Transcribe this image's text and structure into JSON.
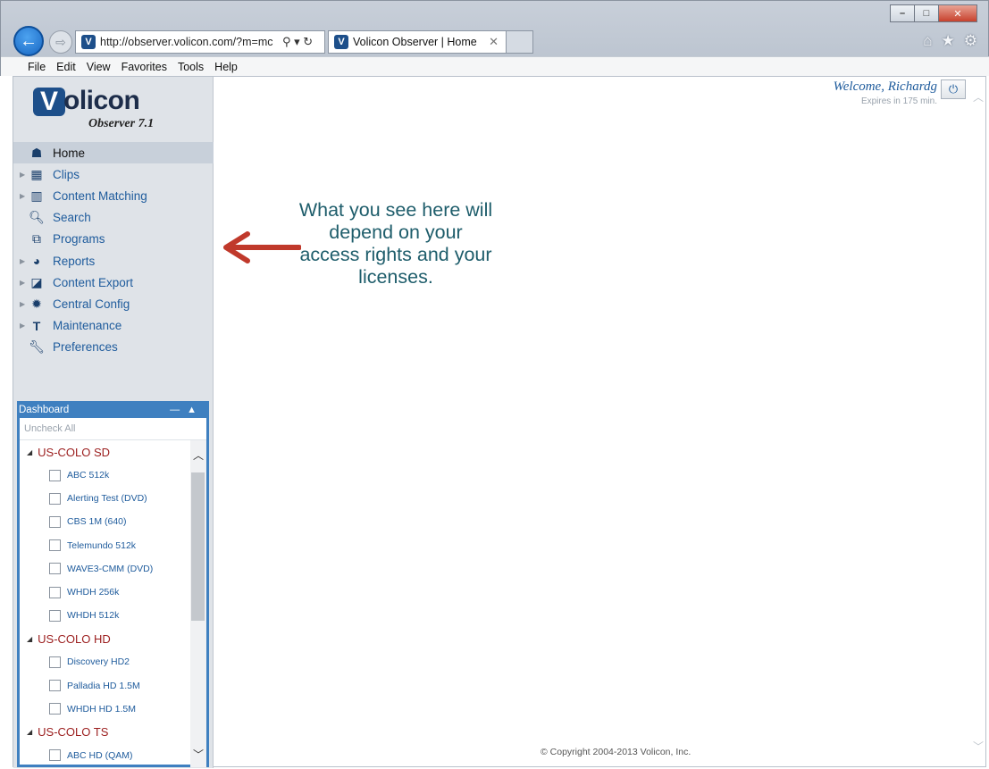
{
  "browser": {
    "address": "http://observer.volicon.com/?m=mc",
    "address_host_bold": "volicon",
    "tab_title": "Volicon Observer | Home",
    "menu": [
      "File",
      "Edit",
      "View",
      "Favorites",
      "Tools",
      "Help"
    ]
  },
  "app": {
    "logo_word": "olicon",
    "logo_mark": "V",
    "logo_sub": "Observer 7.1",
    "welcome": "Welcome, Richardg",
    "expires": "Expires in 175 min.",
    "nav": [
      {
        "label": "Home",
        "icon": "home-icon",
        "active": true,
        "expandable": false
      },
      {
        "label": "Clips",
        "icon": "film-icon",
        "expandable": true
      },
      {
        "label": "Content Matching",
        "icon": "content-matching-icon",
        "expandable": true
      },
      {
        "label": "Search",
        "icon": "search-icon",
        "expandable": false
      },
      {
        "label": "Programs",
        "icon": "programs-icon",
        "expandable": false
      },
      {
        "label": "Reports",
        "icon": "pie-chart-icon",
        "expandable": true
      },
      {
        "label": "Content Export",
        "icon": "clapperboard-icon",
        "expandable": true
      },
      {
        "label": "Central Config",
        "icon": "gear-icon",
        "expandable": true
      },
      {
        "label": "Maintenance",
        "icon": "maintenance-icon",
        "expandable": true
      },
      {
        "label": "Preferences",
        "icon": "wrench-icon",
        "expandable": false
      }
    ],
    "dashboard": {
      "title": "Dashboard",
      "uncheck_all": "Uncheck All",
      "groups": [
        {
          "name": "US-COLO SD",
          "channels": [
            "ABC 512k",
            "Alerting Test (DVD)",
            "CBS 1M (640)",
            "Telemundo 512k",
            "WAVE3-CMM (DVD)",
            "WHDH 256k",
            "WHDH 512k"
          ]
        },
        {
          "name": "US-COLO HD",
          "channels": [
            "Discovery HD2",
            "Palladia HD 1.5M",
            "WHDH HD 1.5M"
          ]
        },
        {
          "name": "US-COLO TS",
          "channels": [
            "ABC HD (QAM)"
          ]
        }
      ]
    },
    "annotation": "What you see here will depend on your access rights and your licenses.",
    "copyright": "© Copyright 2004-2013 Volicon, Inc."
  },
  "colors": {
    "accent": "#1e5b9c",
    "dashboard_header": "#3f80c0",
    "group_red": "#9b1d1d",
    "arrow": "#c0392b"
  }
}
